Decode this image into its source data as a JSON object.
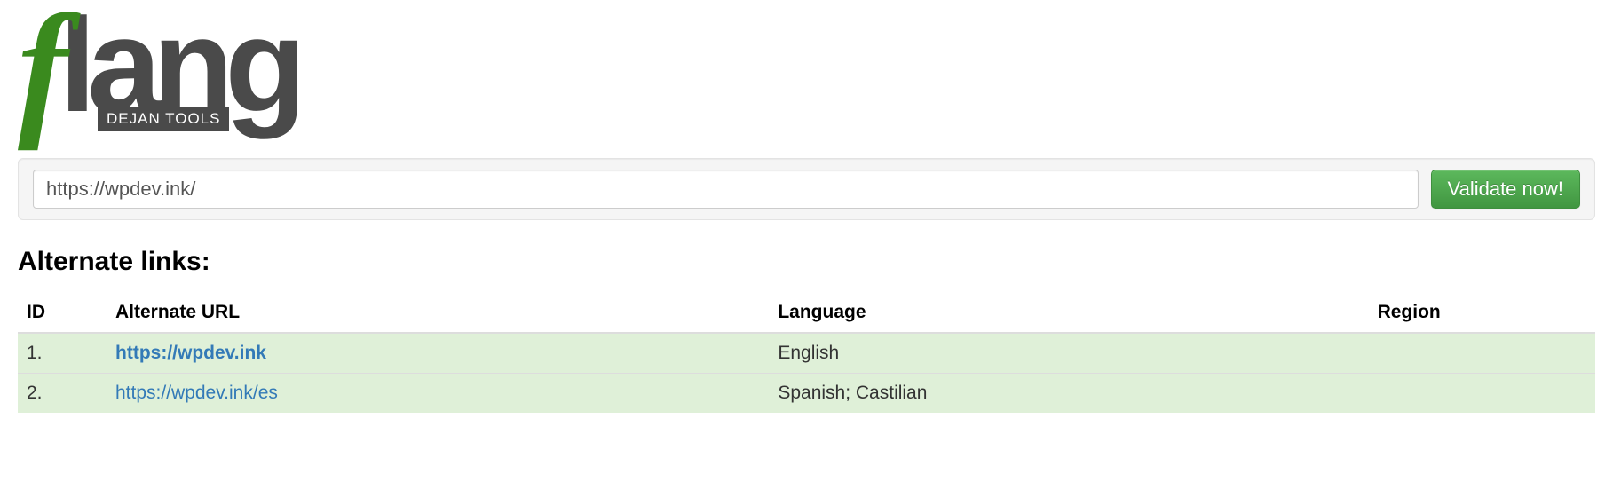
{
  "brand": {
    "name_first": "f",
    "name_rest": "lang",
    "subtitle": "DEJAN TOOLS"
  },
  "search": {
    "value": "https://wpdev.ink/",
    "button": "Validate now!"
  },
  "heading": "Alternate links:",
  "columns": {
    "id": "ID",
    "url": "Alternate URL",
    "lang": "Language",
    "region": "Region"
  },
  "rows": [
    {
      "id": "1.",
      "url": "https://wpdev.ink",
      "lang": "English",
      "region": "",
      "bold": true
    },
    {
      "id": "2.",
      "url": "https://wpdev.ink/es",
      "lang": "Spanish; Castilian",
      "region": "",
      "bold": false
    }
  ]
}
